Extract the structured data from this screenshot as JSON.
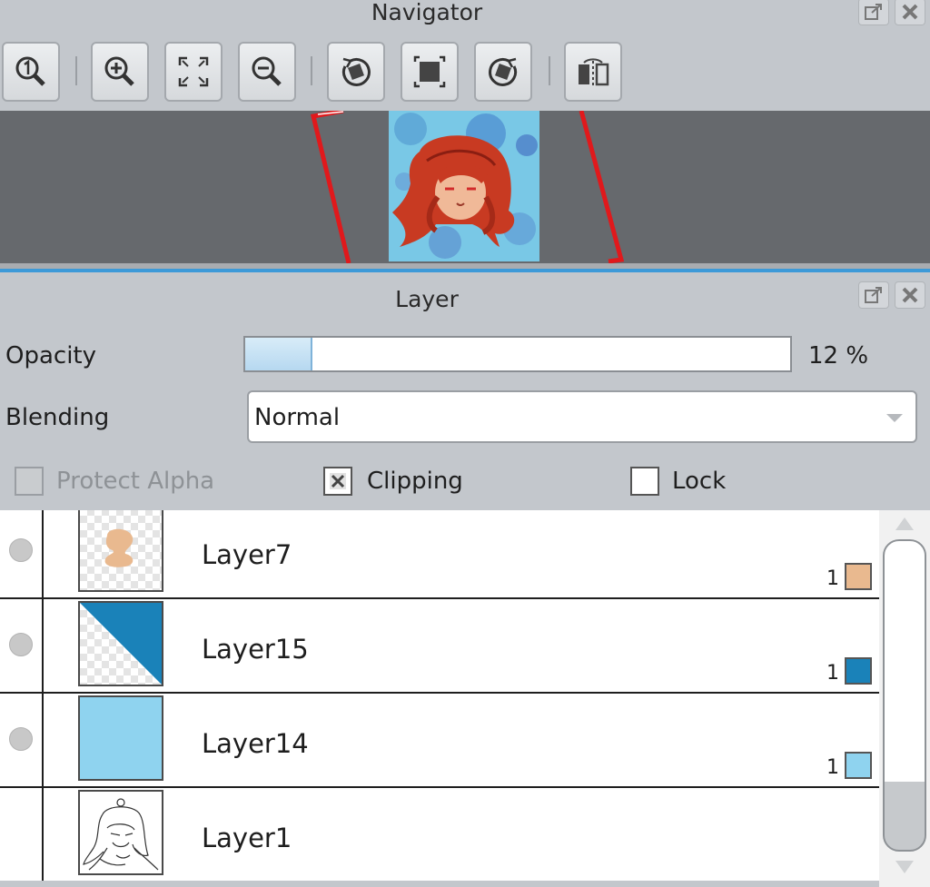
{
  "navigator": {
    "title": "Navigator",
    "toolbar": [
      {
        "icon": "zoom-actual-size-icon"
      },
      {
        "icon": "zoom-in-icon"
      },
      {
        "icon": "fit-to-window-icon"
      },
      {
        "icon": "zoom-out-icon"
      },
      {
        "icon": "rotate-counterclockwise-icon"
      },
      {
        "icon": "reset-rotation-icon"
      },
      {
        "icon": "rotate-clockwise-icon"
      },
      {
        "icon": "flip-horizontal-icon"
      }
    ]
  },
  "layer_panel": {
    "title": "Layer",
    "opacity_label": "Opacity",
    "opacity_value": 12,
    "opacity_text": "12 %",
    "blending_label": "Blending",
    "blending_value": "Normal",
    "protect_alpha_label": "Protect Alpha",
    "protect_alpha_checked": false,
    "protect_alpha_enabled": false,
    "clipping_label": "Clipping",
    "clipping_checked": true,
    "lock_label": "Lock",
    "lock_checked": false,
    "layers": [
      {
        "name": "Layer7",
        "count": "1",
        "color": "#e9b98f",
        "visible": true
      },
      {
        "name": "Layer15",
        "count": "1",
        "color": "#1a82b9",
        "visible": true
      },
      {
        "name": "Layer14",
        "count": "1",
        "color": "#8fd3ef",
        "visible": true
      },
      {
        "name": "Layer1",
        "count": "",
        "color": "",
        "visible": false
      }
    ]
  },
  "colors": {
    "accent": "#3d9ad8",
    "frame": "#e0191c",
    "canvas_bg": "#66696d"
  }
}
